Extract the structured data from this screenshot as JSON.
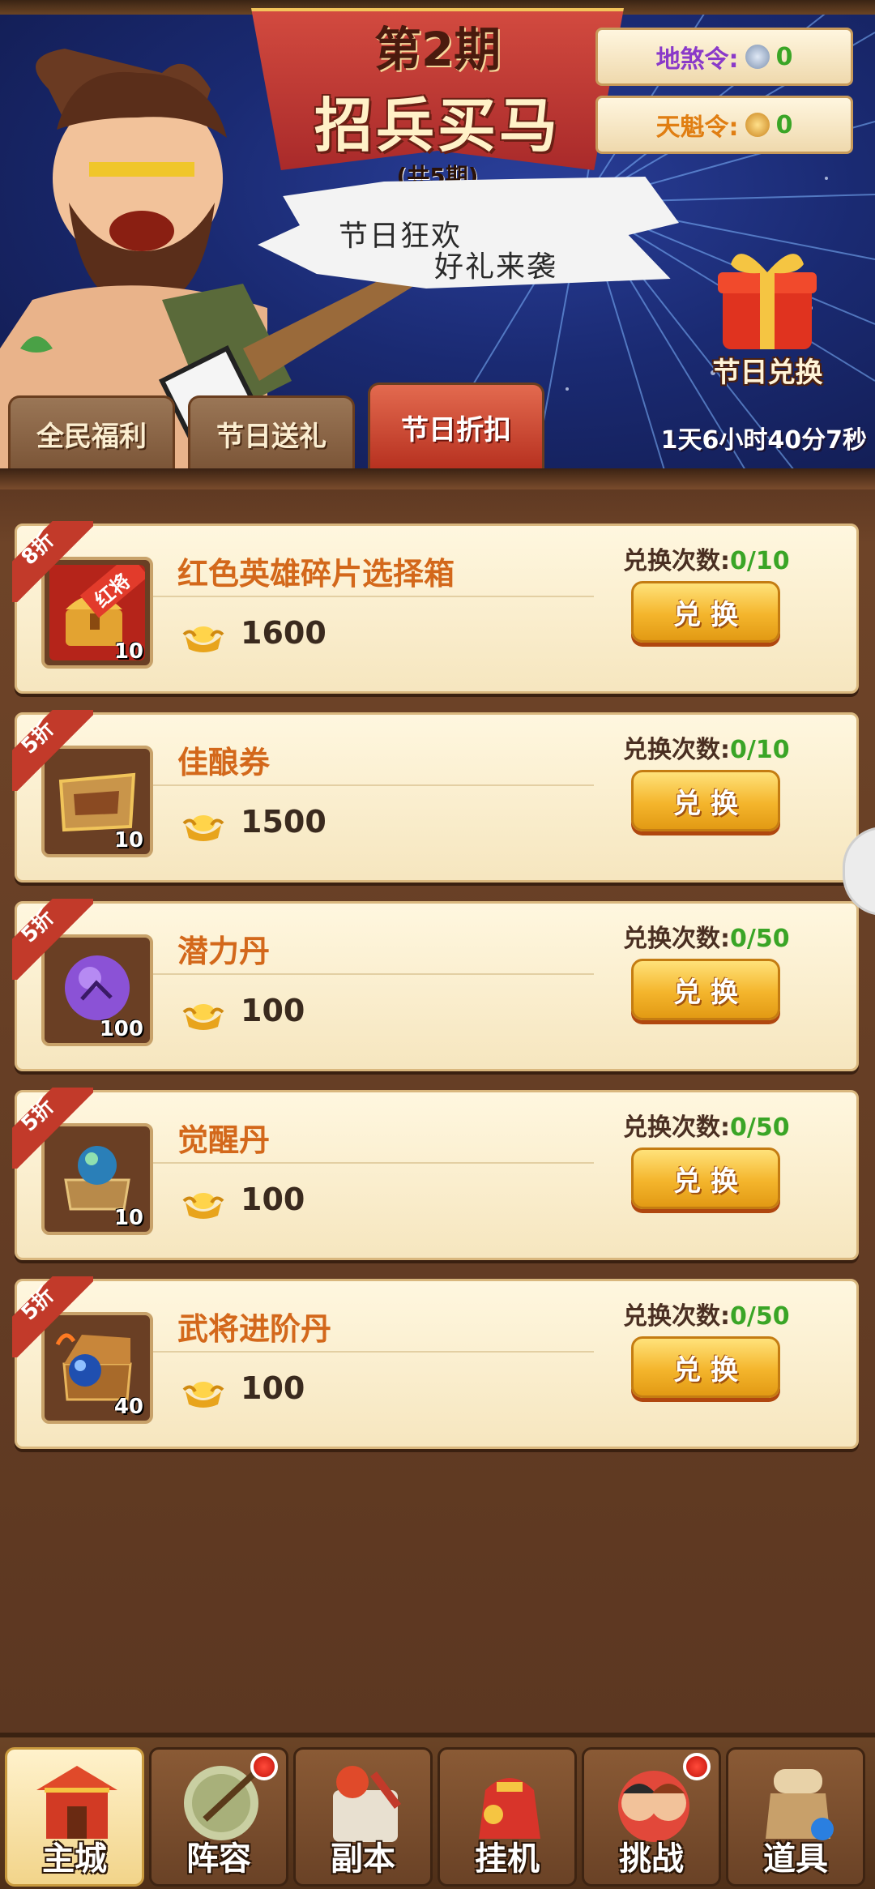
{
  "banner": {
    "period": "第2期",
    "title": "招兵买马",
    "subtitle": "(共5期)",
    "tokens": [
      {
        "label": "地煞令:",
        "value": "0",
        "icon": "silver-token-icon",
        "color": "#8a39c9"
      },
      {
        "label": "天魁令:",
        "value": "0",
        "icon": "gold-token-icon",
        "color": "#e07e12"
      }
    ],
    "speech_line1": "节日狂欢",
    "speech_line2": "好礼来袭",
    "gift_label": "节日兑换",
    "timer": "1天6小时40分7秒"
  },
  "tabs": [
    {
      "label": "全民福利",
      "active": false
    },
    {
      "label": "节日送礼",
      "active": false
    },
    {
      "label": "节日折扣",
      "active": true
    }
  ],
  "items": [
    {
      "discount": "8折",
      "name": "红色英雄碎片选择箱",
      "count": "10",
      "price": "1600",
      "limit_label": "兑换次数:",
      "limit_value": "0/10",
      "button": "兑换",
      "icon": "red-hero-chest-icon",
      "tag": "红将"
    },
    {
      "discount": "5折",
      "name": "佳酿券",
      "count": "10",
      "price": "1500",
      "limit_label": "兑换次数:",
      "limit_value": "0/10",
      "button": "兑换",
      "icon": "wine-ticket-icon"
    },
    {
      "discount": "5折",
      "name": "潜力丹",
      "count": "100",
      "price": "100",
      "limit_label": "兑换次数:",
      "limit_value": "0/50",
      "button": "兑换",
      "icon": "purple-orb-icon"
    },
    {
      "discount": "5折",
      "name": "觉醒丹",
      "count": "10",
      "price": "100",
      "limit_label": "兑换次数:",
      "limit_value": "0/50",
      "button": "兑换",
      "icon": "awaken-orb-icon"
    },
    {
      "discount": "5折",
      "name": "武将进阶丹",
      "count": "40",
      "price": "100",
      "limit_label": "兑换次数:",
      "limit_value": "0/50",
      "button": "兑换",
      "icon": "treasure-chest-orb-icon"
    }
  ],
  "nav": [
    {
      "label": "主城",
      "icon": "city-gate-icon",
      "active": true,
      "badge": false
    },
    {
      "label": "阵容",
      "icon": "lineup-icon",
      "active": false,
      "badge": true
    },
    {
      "label": "副本",
      "icon": "dungeon-icon",
      "active": false,
      "badge": false
    },
    {
      "label": "挂机",
      "icon": "idle-bag-icon",
      "active": false,
      "badge": false
    },
    {
      "label": "挑战",
      "icon": "challenge-icon",
      "active": false,
      "badge": true
    },
    {
      "label": "道具",
      "icon": "items-bag-icon",
      "active": false,
      "badge": false
    }
  ],
  "colors": {
    "accent_red": "#c23a2a",
    "gold": "#f4b52c",
    "green": "#3aa526",
    "name_orange": "#d3681b"
  }
}
